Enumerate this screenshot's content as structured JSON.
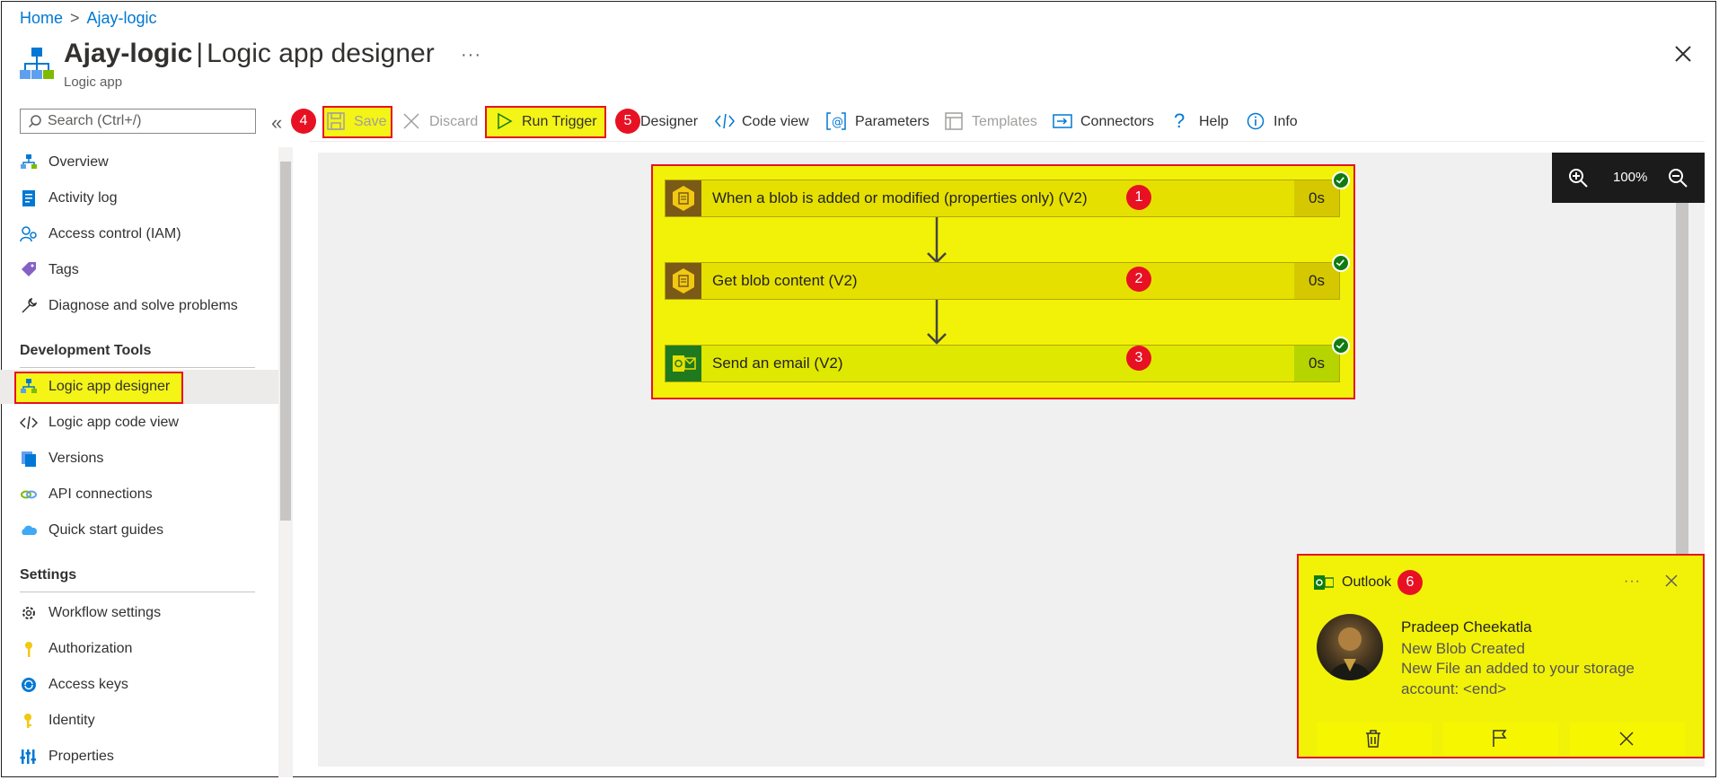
{
  "breadcrumb": {
    "home": "Home",
    "current": "Ajay-logic"
  },
  "header": {
    "title_bold": "Ajay-logic",
    "title_sep": "|",
    "title_rest": "Logic app designer",
    "subtitle": "Logic app",
    "more": "···"
  },
  "sidebar": {
    "search_placeholder": "Search (Ctrl+/)",
    "items": [
      {
        "label": "Overview",
        "icon": "overview-icon"
      },
      {
        "label": "Activity log",
        "icon": "activity-log-icon"
      },
      {
        "label": "Access control (IAM)",
        "icon": "iam-icon"
      },
      {
        "label": "Tags",
        "icon": "tag-icon"
      },
      {
        "label": "Diagnose and solve problems",
        "icon": "wrench-icon"
      }
    ],
    "section_dev": "Development Tools",
    "dev_items": [
      {
        "label": "Logic app designer",
        "icon": "designer-icon",
        "active": true
      },
      {
        "label": "Logic app code view",
        "icon": "code-icon"
      },
      {
        "label": "Versions",
        "icon": "versions-icon"
      },
      {
        "label": "API connections",
        "icon": "api-connections-icon"
      },
      {
        "label": "Quick start guides",
        "icon": "cloud-icon"
      }
    ],
    "section_settings": "Settings",
    "settings_items": [
      {
        "label": "Workflow settings",
        "icon": "gear-icon"
      },
      {
        "label": "Authorization",
        "icon": "key-icon"
      },
      {
        "label": "Access keys",
        "icon": "refresh-key-icon"
      },
      {
        "label": "Identity",
        "icon": "identity-icon"
      },
      {
        "label": "Properties",
        "icon": "properties-icon"
      }
    ]
  },
  "toolbar": {
    "save": "Save",
    "discard": "Discard",
    "run_trigger": "Run Trigger",
    "designer": "Designer",
    "code_view": "Code view",
    "parameters": "Parameters",
    "templates": "Templates",
    "connectors": "Connectors",
    "help": "Help",
    "info": "Info"
  },
  "badges": {
    "b1": "1",
    "b2": "2",
    "b3": "3",
    "b4": "4",
    "b5": "5",
    "b6": "6"
  },
  "zoom": {
    "level": "100%"
  },
  "flow": {
    "steps": [
      {
        "label": "When a blob is added or modified (properties only) (V2)",
        "duration": "0s",
        "icon": "blob-trigger-icon"
      },
      {
        "label": "Get blob content (V2)",
        "duration": "0s",
        "icon": "blob-icon"
      },
      {
        "label": "Send an email (V2)",
        "duration": "0s",
        "icon": "outlook-icon"
      }
    ]
  },
  "notification": {
    "app": "Outlook",
    "more": "···",
    "sender": "Pradeep Cheekatla",
    "subject": "New Blob Created",
    "body": "New File an added to your storage account: <end>"
  },
  "colors": {
    "accent": "#0078d4",
    "highlight": "#f2f208",
    "badge": "#e81123",
    "success": "#107c10"
  }
}
